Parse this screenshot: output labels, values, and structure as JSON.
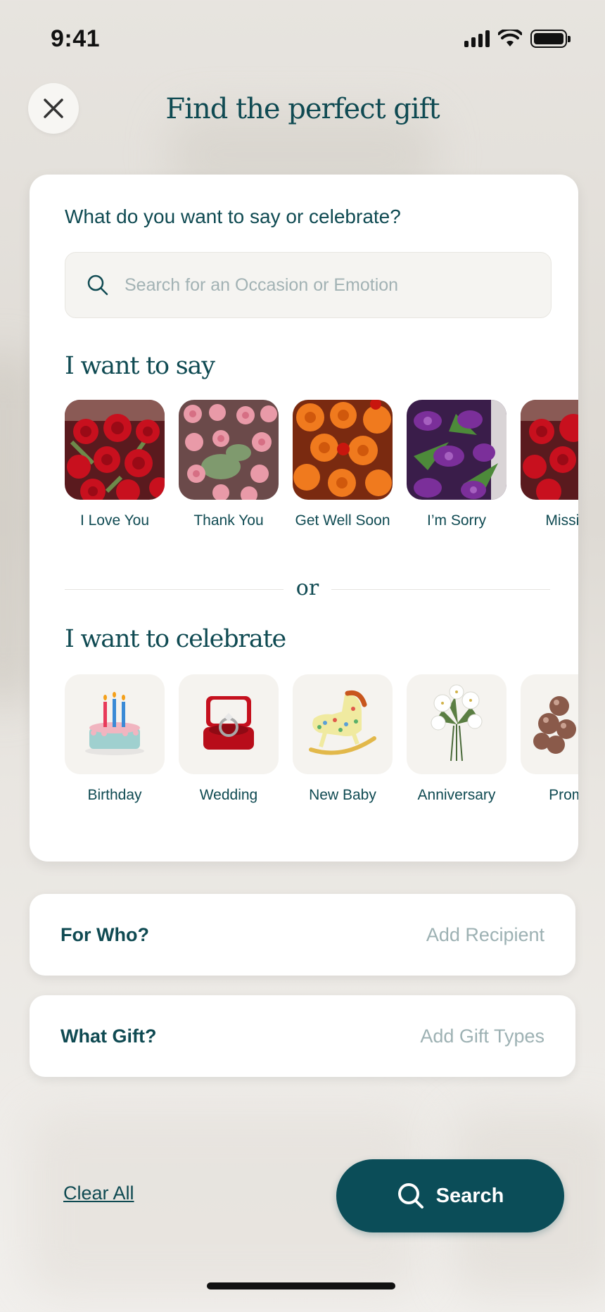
{
  "status_bar": {
    "time": "9:41"
  },
  "header": {
    "title": "Find the perfect gift"
  },
  "card": {
    "question": "What do you want to say or celebrate?",
    "search_placeholder": "Search for an Occasion or Emotion",
    "say_title": "I want to say",
    "say_items": [
      {
        "label": "I Love You",
        "icon": "red-roses"
      },
      {
        "label": "Thank You",
        "icon": "pink-roses"
      },
      {
        "label": "Get Well Soon",
        "icon": "orange-roses"
      },
      {
        "label": "I’m Sorry",
        "icon": "purple-alstroemeria"
      },
      {
        "label": "Missing",
        "icon": "red-roses"
      }
    ],
    "or_label": "or",
    "celebrate_title": "I want to celebrate",
    "celebrate_items": [
      {
        "label": "Birthday",
        "icon": "birthday-cake-icon"
      },
      {
        "label": "Wedding",
        "icon": "ring-box-icon"
      },
      {
        "label": "New Baby",
        "icon": "rocking-horse-icon"
      },
      {
        "label": "Anniversary",
        "icon": "lily-bouquet-icon"
      },
      {
        "label": "Promo",
        "icon": "balloons-icon"
      }
    ]
  },
  "for_who": {
    "label": "For Who?",
    "value": "Add Recipient"
  },
  "what_gift": {
    "label": "What Gift?",
    "value": "Add Gift Types"
  },
  "footer": {
    "clear_label": "Clear All",
    "search_label": "Search"
  },
  "colors": {
    "primary": "#0b4d58",
    "text": "#0f4a52",
    "muted": "#9db1b3"
  }
}
